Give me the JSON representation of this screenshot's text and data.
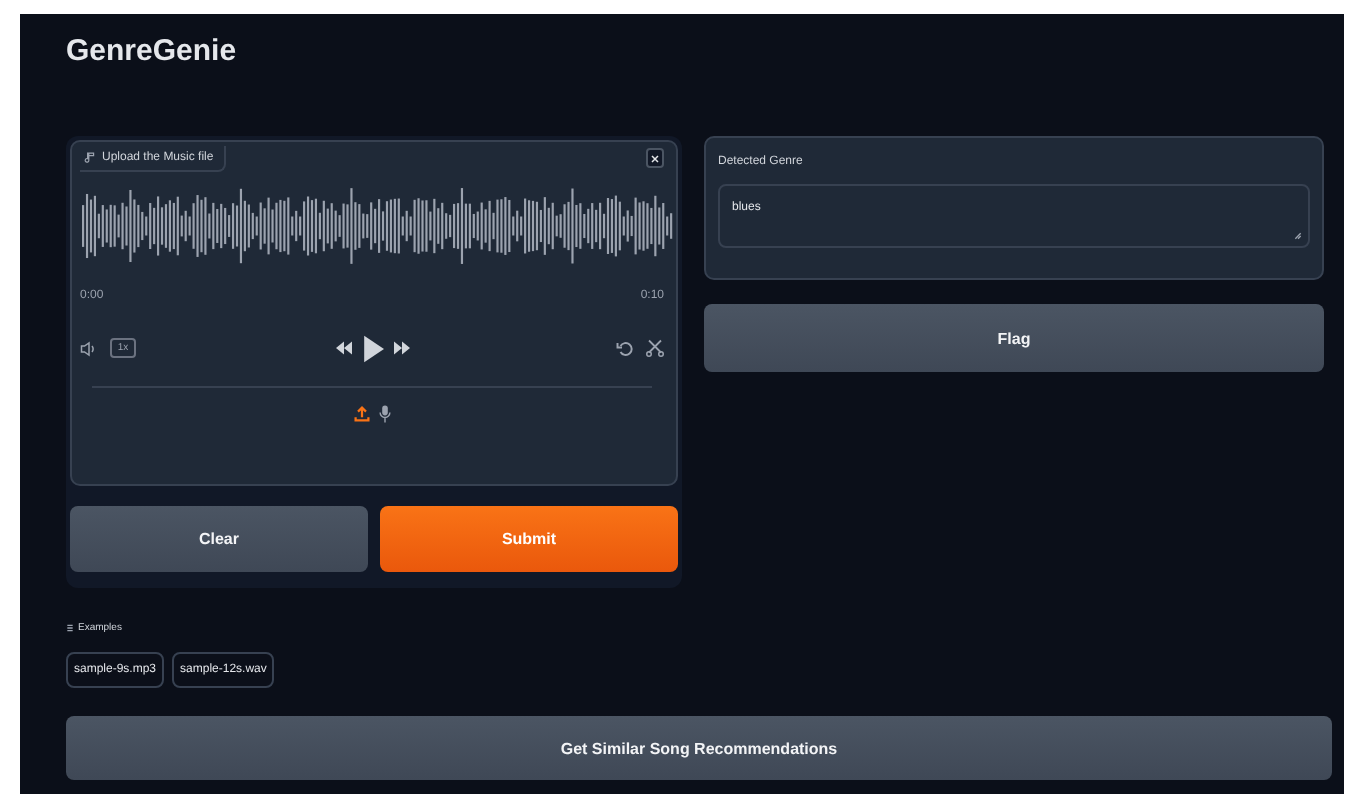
{
  "app": {
    "title": "GenreGenie"
  },
  "audio_input": {
    "label": "Upload the Music file",
    "current_time": "0:00",
    "duration": "0:10",
    "speed": "1x",
    "sources": [
      {
        "kind": "upload",
        "selected": true
      },
      {
        "kind": "microphone",
        "selected": false
      }
    ]
  },
  "buttons": [
    {
      "label": "Clear",
      "kind": "secondary"
    },
    {
      "label": "Submit",
      "kind": "primary"
    }
  ],
  "examples": {
    "label": "Examples",
    "items": [
      "sample-9s.mp3",
      "sample-12s.wav"
    ]
  },
  "output": {
    "label": "Detected Genre",
    "value": "blues"
  },
  "flag_button": {
    "label": "Flag"
  },
  "recommend_button": {
    "label": "Get Similar Song Recommendations"
  }
}
